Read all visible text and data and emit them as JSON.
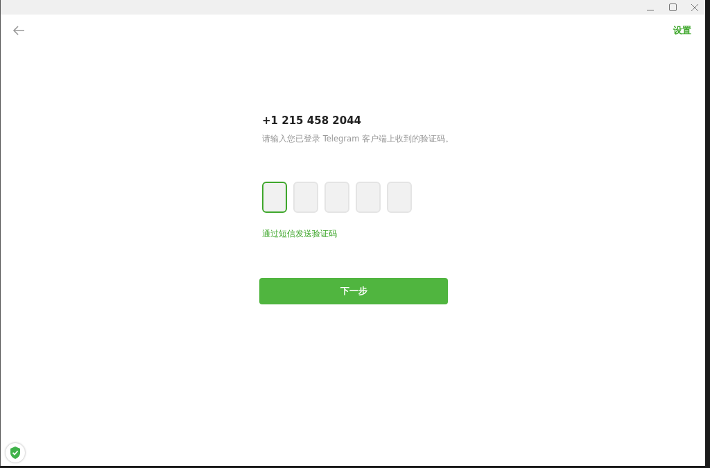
{
  "window": {
    "controls": [
      {
        "kind": "minimize"
      },
      {
        "kind": "maximize"
      },
      {
        "kind": "close"
      }
    ]
  },
  "header": {
    "settings_link": "设置"
  },
  "phone": "+1 215 458 2044",
  "hint": "请输入您已登录 Telegram 客户端上收到的验证码。",
  "code_boxes": [
    {
      "selected": true
    },
    {
      "selected": false
    },
    {
      "selected": false
    },
    {
      "selected": false
    },
    {
      "selected": false
    }
  ],
  "sms_link": "通过短信发送验证码",
  "next_button": "下一步"
}
